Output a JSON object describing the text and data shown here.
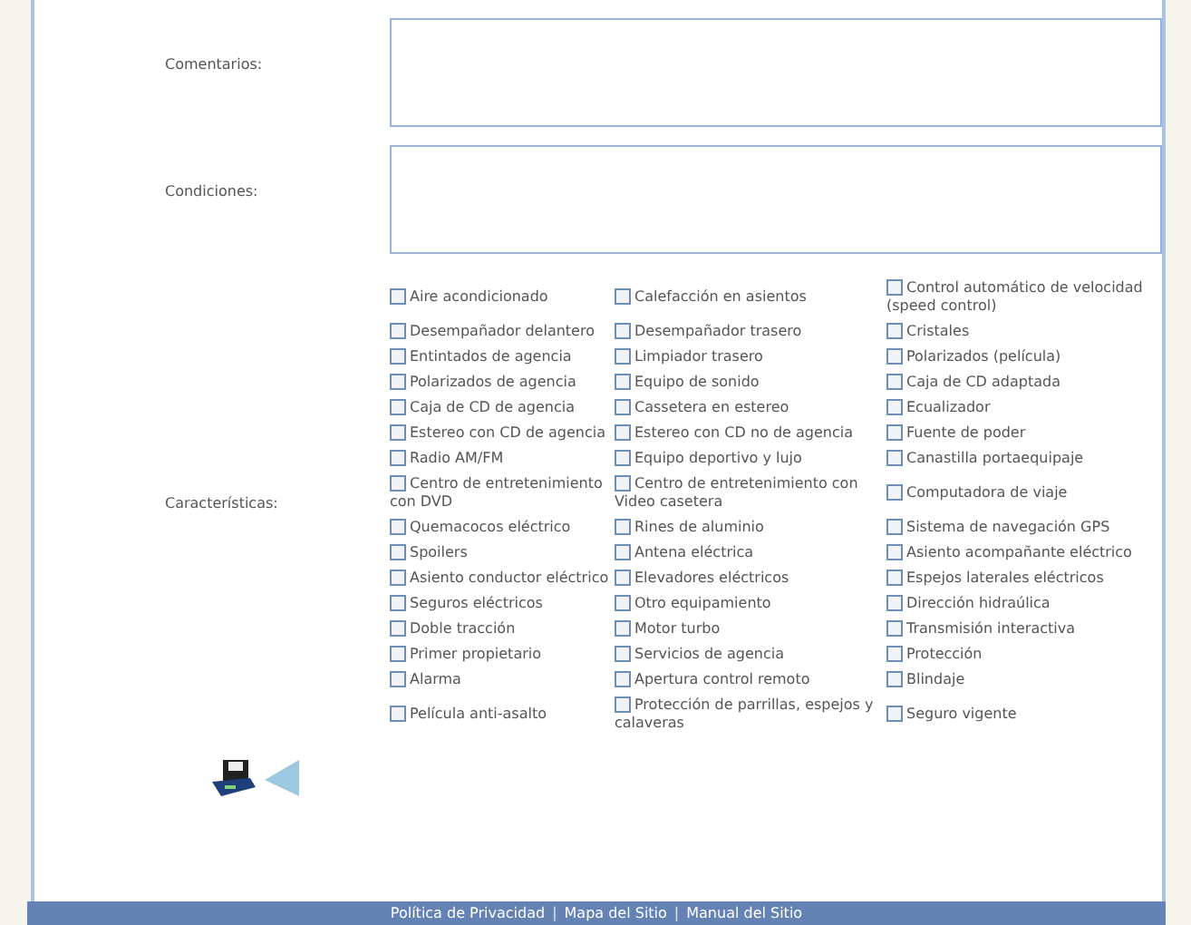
{
  "fields": [
    {
      "label": "Comentarios:"
    },
    {
      "label": "Condiciones:"
    }
  ],
  "features": {
    "label": "Características:",
    "options": [
      {
        "label": "Aire acondicionado",
        "checked": false
      },
      {
        "label": "Calefacción en asientos",
        "checked": false
      },
      {
        "label": "Control automático de velocidad (speed control)",
        "checked": false
      },
      {
        "label": "Desempañador delantero",
        "checked": false
      },
      {
        "label": "Desempañador trasero",
        "checked": false
      },
      {
        "label": "Cristales",
        "checked": false
      },
      {
        "label": "Entintados de agencia",
        "checked": false
      },
      {
        "label": "Limpiador trasero",
        "checked": false
      },
      {
        "label": "Polarizados (película)",
        "checked": false
      },
      {
        "label": "Polarizados de agencia",
        "checked": false
      },
      {
        "label": "Equipo de sonido",
        "checked": false
      },
      {
        "label": "Caja de CD adaptada",
        "checked": false
      },
      {
        "label": "Caja de CD de agencia",
        "checked": false
      },
      {
        "label": "Cassetera en estereo",
        "checked": false
      },
      {
        "label": "Ecualizador",
        "checked": false
      },
      {
        "label": "Estereo con CD de agencia",
        "checked": false
      },
      {
        "label": "Estereo con CD no de agencia",
        "checked": false
      },
      {
        "label": "Fuente de poder",
        "checked": false
      },
      {
        "label": "Radio AM/FM",
        "checked": false
      },
      {
        "label": "Equipo deportivo y lujo",
        "checked": false
      },
      {
        "label": "Canastilla portaequipaje",
        "checked": false
      },
      {
        "label": "Centro de entretenimiento con DVD",
        "checked": false
      },
      {
        "label": "Centro de entretenimiento con Video casetera",
        "checked": false
      },
      {
        "label": "Computadora de viaje",
        "checked": false
      },
      {
        "label": "Quemacocos eléctrico",
        "checked": false
      },
      {
        "label": "Rines de aluminio",
        "checked": false
      },
      {
        "label": "Sistema de navegación GPS",
        "checked": false
      },
      {
        "label": "Spoilers",
        "checked": false
      },
      {
        "label": "Antena eléctrica",
        "checked": false
      },
      {
        "label": "Asiento acompañante eléctrico",
        "checked": false
      },
      {
        "label": "Asiento conductor eléctrico",
        "checked": false
      },
      {
        "label": "Elevadores eléctricos",
        "checked": false
      },
      {
        "label": "Espejos laterales eléctricos",
        "checked": false
      },
      {
        "label": "Seguros eléctricos",
        "checked": false
      },
      {
        "label": "Otro equipamiento",
        "checked": false
      },
      {
        "label": "Dirección hidraúlica",
        "checked": false
      },
      {
        "label": "Doble tracción",
        "checked": false
      },
      {
        "label": "Motor turbo",
        "checked": false
      },
      {
        "label": "Transmisión interactiva",
        "checked": false
      },
      {
        "label": "Primer propietario",
        "checked": false
      },
      {
        "label": "Servicios de agencia",
        "checked": false
      },
      {
        "label": "Protección",
        "checked": false
      },
      {
        "label": "Alarma",
        "checked": false
      },
      {
        "label": "Apertura control remoto",
        "checked": false
      },
      {
        "label": "Blindaje",
        "checked": false
      },
      {
        "label": "Película anti-asalto",
        "checked": false
      },
      {
        "label": "Protección de parrillas, espejos y calaveras",
        "checked": false
      },
      {
        "label": "Seguro vigente",
        "checked": false
      }
    ]
  },
  "footer": [
    {
      "kind": "link",
      "text": "Política de Privacidad"
    },
    {
      "kind": "separator",
      "text": "|"
    },
    {
      "kind": "link",
      "text": "Mapa del Sitio"
    },
    {
      "kind": "separator",
      "text": "|"
    },
    {
      "kind": "link",
      "text": "Manual del Sitio"
    }
  ]
}
